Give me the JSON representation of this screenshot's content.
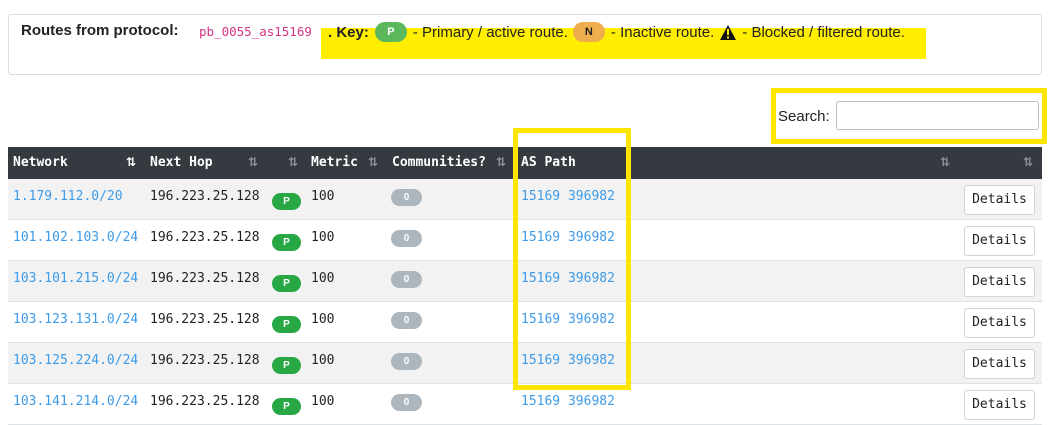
{
  "header": {
    "title": "Routes from protocol:",
    "protocol": "pb_0055_as15169",
    "key_label": ". Key:",
    "primary_badge": "P",
    "primary_text": "- Primary / active route.",
    "inactive_badge": "N",
    "inactive_text": "- Inactive route.",
    "blocked_icon": "warning-icon",
    "blocked_text": "- Blocked / filtered route."
  },
  "search": {
    "label": "Search:",
    "value": "",
    "placeholder": ""
  },
  "table": {
    "columns": [
      "Network",
      "Next Hop",
      "Metric",
      "Communities?",
      "AS Path"
    ],
    "details_label": "Details",
    "rows": [
      {
        "network": "1.179.112.0/20",
        "next_hop": "196.223.25.128",
        "status": "P",
        "metric": "100",
        "communities": "0",
        "as_path": "15169 396982"
      },
      {
        "network": "101.102.103.0/24",
        "next_hop": "196.223.25.128",
        "status": "P",
        "metric": "100",
        "communities": "0",
        "as_path": "15169 396982"
      },
      {
        "network": "103.101.215.0/24",
        "next_hop": "196.223.25.128",
        "status": "P",
        "metric": "100",
        "communities": "0",
        "as_path": "15169 396982"
      },
      {
        "network": "103.123.131.0/24",
        "next_hop": "196.223.25.128",
        "status": "P",
        "metric": "100",
        "communities": "0",
        "as_path": "15169 396982"
      },
      {
        "network": "103.125.224.0/24",
        "next_hop": "196.223.25.128",
        "status": "P",
        "metric": "100",
        "communities": "0",
        "as_path": "15169 396982"
      },
      {
        "network": "103.141.214.0/24",
        "next_hop": "196.223.25.128",
        "status": "P",
        "metric": "100",
        "communities": "0",
        "as_path": "15169 396982"
      }
    ]
  },
  "colors": {
    "highlight": "#ffee00",
    "header_bg": "#343a40",
    "link": "#3d9be9",
    "primary": "#28a745",
    "inactive": "#f0ad4e",
    "code": "#d63384"
  }
}
